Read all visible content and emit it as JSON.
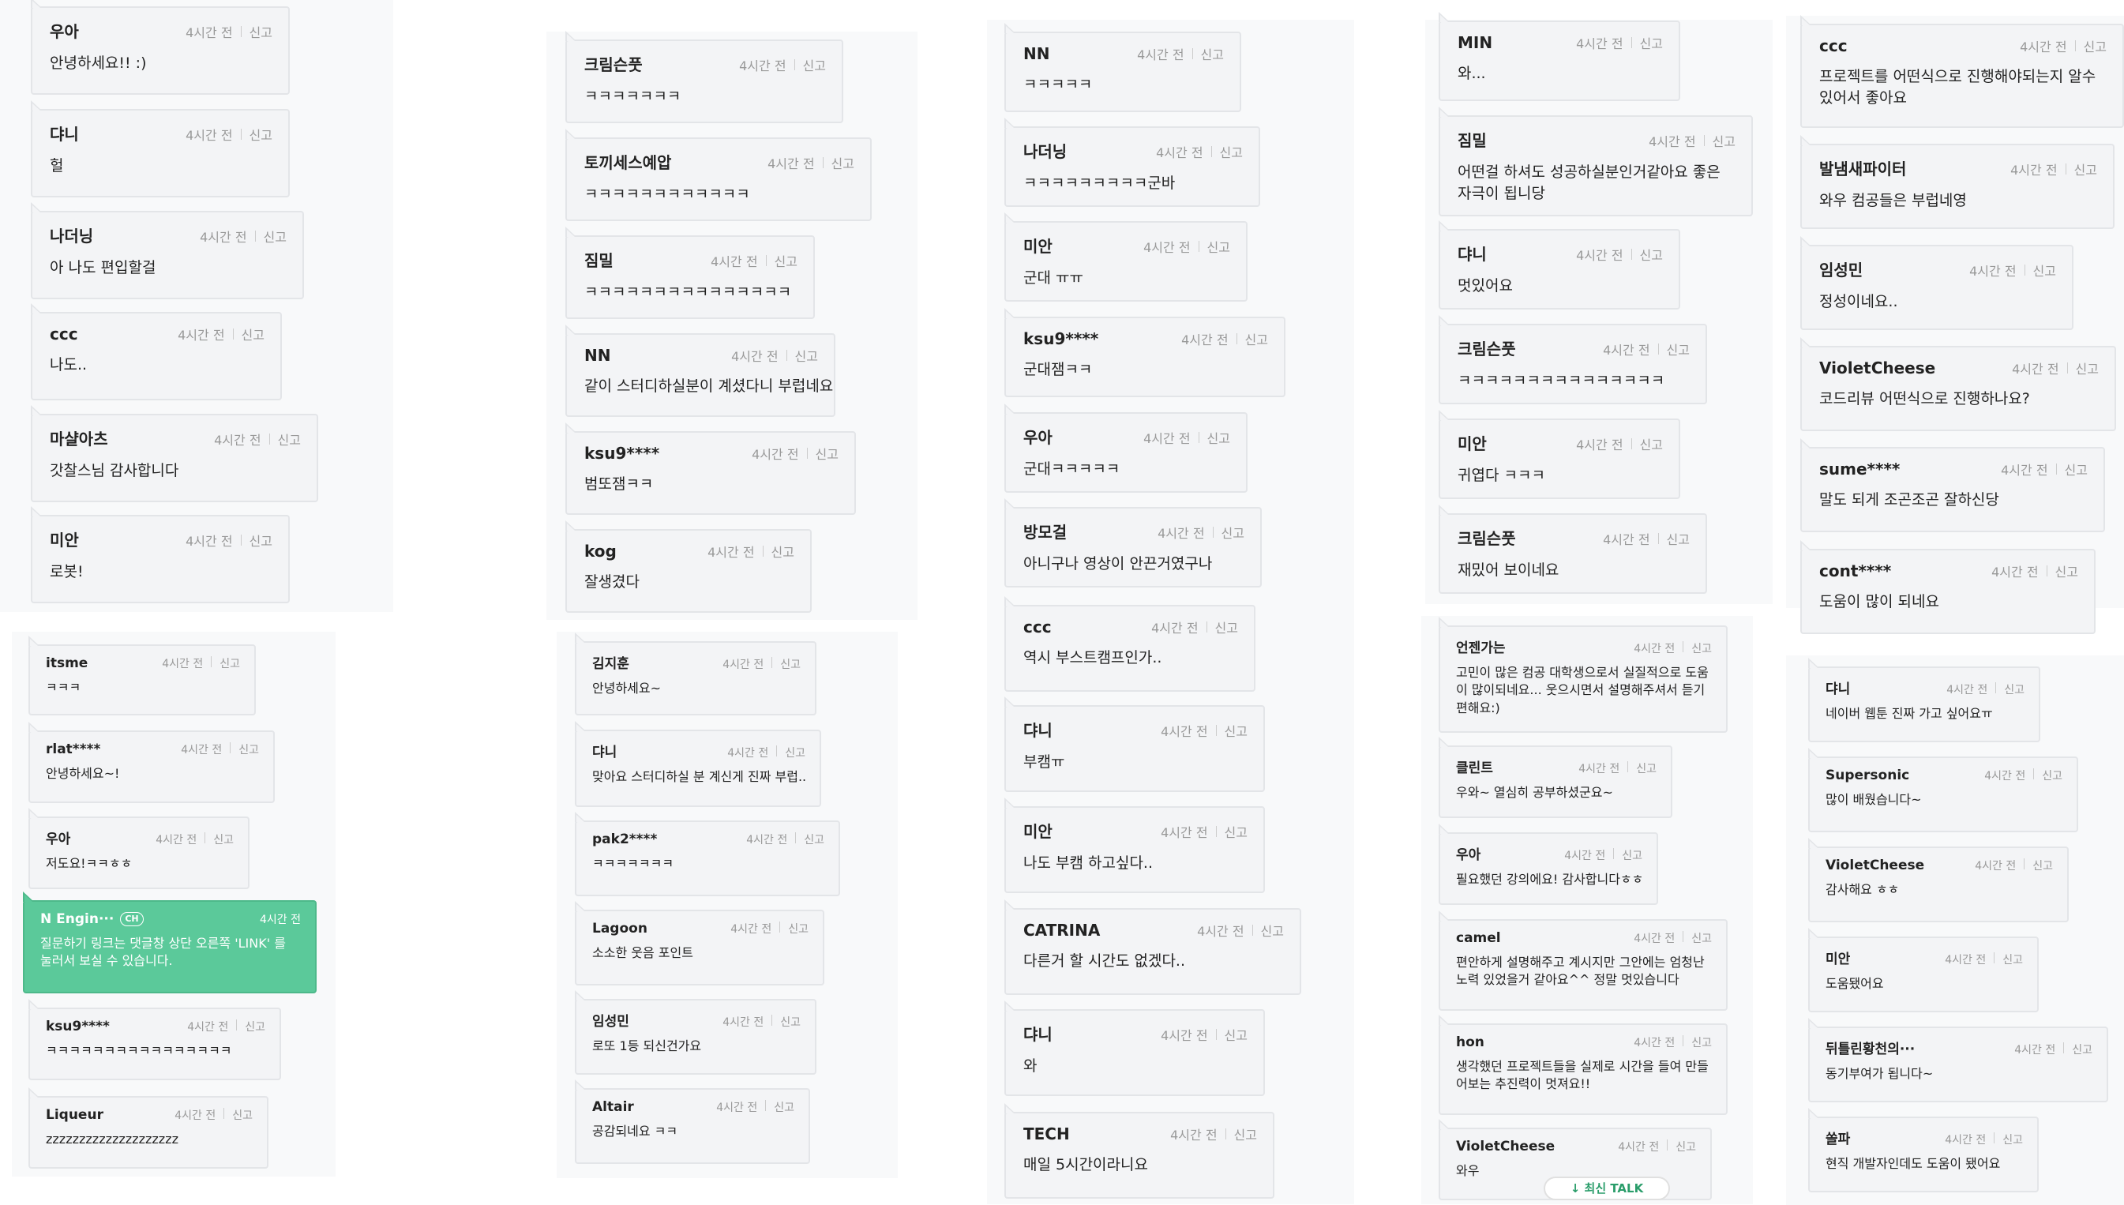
{
  "common": {
    "time": "4시간 전",
    "report": "신고"
  },
  "col1a": [
    {
      "name": "우아",
      "msg": "안녕하세요!! :)"
    },
    {
      "name": "댜니",
      "msg": "헐"
    },
    {
      "name": "나더닝",
      "msg": "아 나도 편입할걸"
    },
    {
      "name": "ccc",
      "msg": "나도.."
    },
    {
      "name": "마샬아츠",
      "msg": "갓찰스님 감사합니다"
    },
    {
      "name": "미안",
      "msg": "로봇!"
    }
  ],
  "col1b": [
    {
      "name": "itsme",
      "msg": "ㅋㅋㅋ"
    },
    {
      "name": "rlat****",
      "msg": "안녕하세요~!"
    },
    {
      "name": "우아",
      "msg": "저도요!ㅋㅋㅎㅎ"
    },
    {
      "name": "N Engin···",
      "badge": "CH",
      "msg": "질문하기 링크는 댓글창 상단 오른쪽 'LINK' 를 눌러서 보실 수 있습니다."
    },
    {
      "name": "ksu9****",
      "msg": "ㅋㅋㅋㅋㅋㅋㅋㅋㅋㅋㅋㅋㅋㅋㅋㅋ"
    },
    {
      "name": "Liqueur",
      "msg": "zzzzzzzzzzzzzzzzzzzz"
    }
  ],
  "col2a": [
    {
      "name": "크림슨풋",
      "msg": "ㅋㅋㅋㅋㅋㅋㅋ"
    },
    {
      "name": "토끼세스예압",
      "msg": "ㅋㅋㅋㅋㅋㅋㅋㅋㅋㅋㅋㅋ"
    },
    {
      "name": "짐밀",
      "msg": "ㅋㅋㅋㅋㅋㅋㅋㅋㅋㅋㅋㅋㅋㅋㅋ"
    },
    {
      "name": "NN",
      "msg": "같이 스터디하실분이 계셨다니 부럽네요"
    },
    {
      "name": "ksu9****",
      "msg": "범또잼ㅋㅋ"
    },
    {
      "name": "kog",
      "msg": "잘생겼다"
    }
  ],
  "col2b": [
    {
      "name": "김지훈",
      "msg": "안녕하세요~"
    },
    {
      "name": "댜니",
      "msg": "맞아요 스터디하실 분 계신게 진짜 부럽.."
    },
    {
      "name": "pak2****",
      "msg": "ㅋㅋㅋㅋㅋㅋㅋ"
    },
    {
      "name": "Lagoon",
      "msg": "소소한 웃음 포인트"
    },
    {
      "name": "임성민",
      "msg": "로또 1등 되신건가요"
    },
    {
      "name": "Altair",
      "msg": "공감되네요 ㅋㅋ"
    }
  ],
  "col3": [
    {
      "name": "NN",
      "msg": "ㅋㅋㅋㅋㅋ"
    },
    {
      "name": "나더닝",
      "msg": "ㅋㅋㅋㅋㅋㅋㅋㅋㅋ군바"
    },
    {
      "name": "미안",
      "msg": "군대 ㅠㅠ"
    },
    {
      "name": "ksu9****",
      "msg": "군대잼ㅋㅋ"
    },
    {
      "name": "우아",
      "msg": "군대ㅋㅋㅋㅋㅋ"
    },
    {
      "name": "방모걸",
      "msg": "아니구나 영상이 안끈거였구나"
    },
    {
      "name": "ccc",
      "msg": "역시 부스트캠프인가.."
    },
    {
      "name": "댜니",
      "msg": "부캠ㅠ"
    },
    {
      "name": "미안",
      "msg": "나도 부캠 하고싶다.."
    },
    {
      "name": "CATRINA",
      "msg": "다른거 할 시간도 없겠다.."
    },
    {
      "name": "댜니",
      "msg": "와"
    },
    {
      "name": "TECH",
      "msg": "매일 5시간이라니요"
    }
  ],
  "col4a": [
    {
      "name": "MIN",
      "msg": "와..."
    },
    {
      "name": "짐밀",
      "msg": "어떤걸 하셔도 성공하실분인거같아요 좋은 자극이 됩니당"
    },
    {
      "name": "댜니",
      "msg": "멋있어요"
    },
    {
      "name": "크림슨풋",
      "msg": "ㅋㅋㅋㅋㅋㅋㅋㅋㅋㅋㅋㅋㅋㅋㅋ"
    },
    {
      "name": "미안",
      "msg": "귀엽다 ㅋㅋㅋ"
    },
    {
      "name": "크림슨풋",
      "msg": "재밌어 보이네요"
    }
  ],
  "col4b": [
    {
      "name": "언젠가는",
      "msg": "고민이 많은 컴공 대학생으로서 실질적으로 도움이 많이되네요... 웃으시면서 설명해주셔서 듣기 편해요:)"
    },
    {
      "name": "클린트",
      "msg": "우와~ 열심히 공부하셨군요~"
    },
    {
      "name": "우아",
      "msg": "필요했던 강의에요! 감사합니다ㅎㅎ"
    },
    {
      "name": "camel",
      "msg": "편안하게 설명해주고 계시지만 그안에는 엄청난 노력 있었을거 같아요^^ 정말 멋있습니다"
    },
    {
      "name": "hon",
      "msg": "생각했던 프로젝트들을 실제로 시간을 들여 만들어보는 추진력이 멋져요!!"
    },
    {
      "name": "VioletCheese",
      "msg": "와우"
    }
  ],
  "col5a": [
    {
      "name": "ccc",
      "msg": "프로젝트를 어떤식으로 진행해야되는지 알수있어서 좋아요"
    },
    {
      "name": "발냄새파이터",
      "msg": "와우 컴공들은 부럽네영"
    },
    {
      "name": "임성민",
      "msg": "정성이네요.."
    },
    {
      "name": "VioletCheese",
      "msg": "코드리뷰 어떤식으로 진행하나요?"
    },
    {
      "name": "sume****",
      "msg": "말도 되게 조곤조곤 잘하신당"
    },
    {
      "name": "cont****",
      "msg": "도움이 많이 되네요"
    }
  ],
  "col5b": [
    {
      "name": "댜니",
      "msg": "네이버 웹툰 진짜 가고 싶어요ㅠ"
    },
    {
      "name": "Supersonic",
      "msg": "많이 배웠습니다~"
    },
    {
      "name": "VioletCheese",
      "msg": "감사해요 ㅎㅎ"
    },
    {
      "name": "미안",
      "msg": "도움됐어요"
    },
    {
      "name": "뒤틀린황천의···",
      "msg": "동기부여가 됩니다~"
    },
    {
      "name": "쏠파",
      "msg": "현직 개발자인데도 도움이 됐어요"
    }
  ],
  "latest_button": "↓ 최신 TALK"
}
